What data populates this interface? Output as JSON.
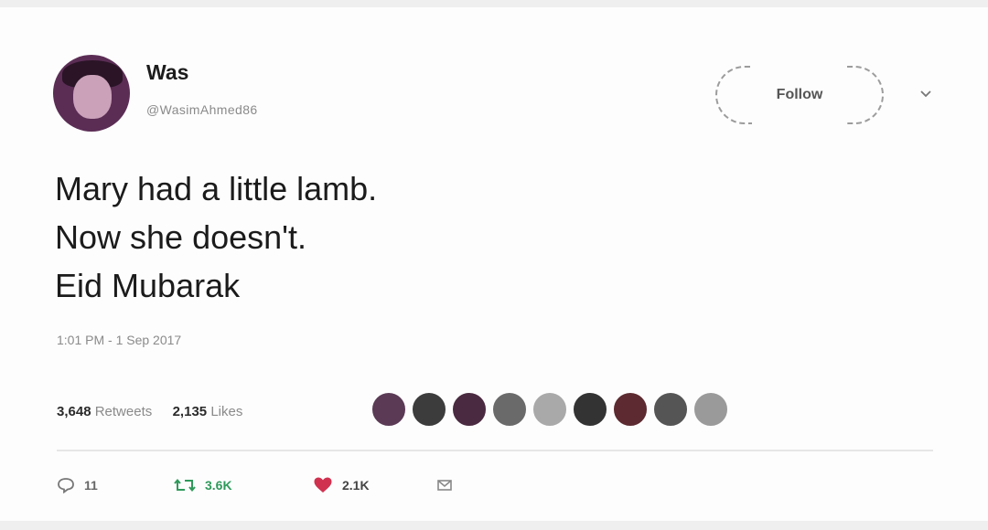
{
  "author": {
    "name": "Was",
    "handle": "@WasimAhmed86"
  },
  "follow_label": "Follow",
  "tweet": {
    "lines": [
      "Mary had a little lamb.",
      "Now she doesn't.",
      "Eid Mubarak"
    ],
    "timestamp": "1:01 PM - 1 Sep 2017"
  },
  "stats": {
    "retweets_count": "3,648",
    "retweets_label": "Retweets",
    "likes_count": "2,135",
    "likes_label": "Likes"
  },
  "liker_avatar_colors": [
    "#5a3a55",
    "#3c3c3c",
    "#4a2a40",
    "#6a6a6a",
    "#a9a9a9",
    "#333333",
    "#5c2a30",
    "#555555",
    "#9a9a9a"
  ],
  "actions": {
    "reply_count": "11",
    "retweet_count": "3.6K",
    "like_count": "2.1K"
  },
  "colors": {
    "retweet_green": "#2f9a5b",
    "like_red": "#d0314f",
    "card_bg": "#fdfdfd"
  }
}
